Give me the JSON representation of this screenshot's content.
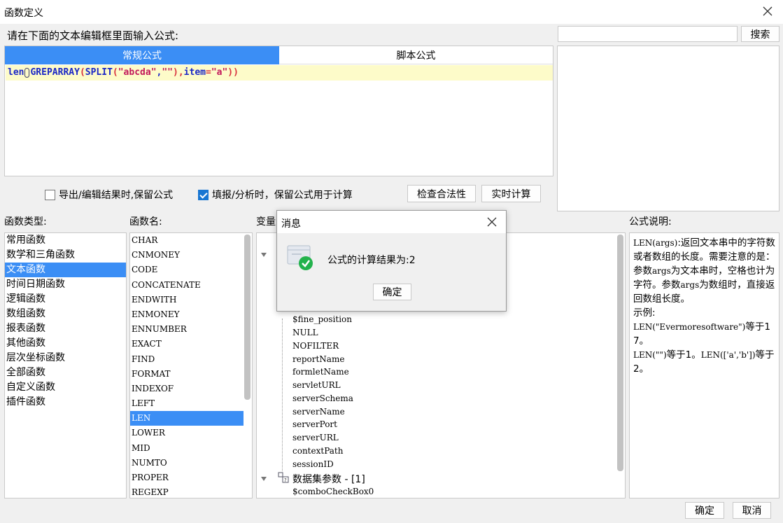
{
  "window": {
    "title": "函数定义"
  },
  "prompt": "请在下面的文本编辑框里面输入公式:",
  "search": {
    "value": "",
    "button": "搜索"
  },
  "editor": {
    "tabs": [
      {
        "label": "常规公式",
        "selected": true
      },
      {
        "label": "脚本公式",
        "selected": false
      }
    ],
    "formula": {
      "p1": "len",
      "p2": "GREPARRAY",
      "p3": "(",
      "p4": "SPLIT",
      "p5": "(",
      "p6": "\"abcda\"",
      "p7": ",",
      "p8": "\"\"",
      "p9": "),",
      "p10": "item",
      "p11": "=",
      "p12": "\"a\"",
      "p13": "))"
    }
  },
  "options": {
    "export_keep": {
      "label": "导出/编辑结果时,保留公式",
      "checked": false
    },
    "fill_keep": {
      "label": "填报/分析时，保留公式用于计算",
      "checked": true
    },
    "check_button": "检查合法性",
    "realtime_button": "实时计算"
  },
  "labels": {
    "categories": "函数类型:",
    "functions": "函数名:",
    "variables": "变量",
    "description": "公式说明:"
  },
  "categories": [
    "常用函数",
    "数学和三角函数",
    "文本函数",
    "时间日期函数",
    "逻辑函数",
    "数组函数",
    "报表函数",
    "其他函数",
    "层次坐标函数",
    "全部函数",
    "自定义函数",
    "插件函数"
  ],
  "selected_category": "文本函数",
  "functions": [
    "CHAR",
    "CNMONEY",
    "CODE",
    "CONCATENATE",
    "ENDWITH",
    "ENMONEY",
    "ENNUMBER",
    "EXACT",
    "FIND",
    "FORMAT",
    "INDEXOF",
    "LEFT",
    "LEN",
    "LOWER",
    "MID",
    "NUMTO",
    "PROPER",
    "REGEXP"
  ],
  "selected_function": "LEN",
  "variables": {
    "items": [
      "$fine_position",
      "NULL",
      "NOFILTER",
      "reportName",
      "formletName",
      "servletURL",
      "serverSchema",
      "serverName",
      "serverPort",
      "serverURL",
      "contextPath",
      "sessionID"
    ],
    "group_label": "数据集参数 - [1]",
    "group_items": [
      "$comboCheckBox0"
    ]
  },
  "description": {
    "l1": "LEN",
    "l2": "(args)",
    "l3": ":返回文本串中的字符数或者数组的长度。需要注意的是：参数",
    "l4": "args",
    "l5": "为文本串时，空格也计为字符。参数",
    "l6": "args",
    "l7": "为数组时，直接返回数组长度。",
    "l8": "示例:",
    "l9": "LEN(\"Evermoresoftware\")",
    "l10": "等于17。",
    "l11": "LEN(\"\")",
    "l12": "等于1。",
    "l13": "LEN(['a','b'])",
    "l14": "等于2。"
  },
  "footer": {
    "ok": "确定",
    "cancel": "取消"
  },
  "dialog": {
    "title": "消息",
    "message": "公式的计算结果为:2",
    "ok": "确定"
  },
  "colors": {
    "accent": "#3b8ef5",
    "formula_bg": "#fdfbc9",
    "function_text": "#1a26c6",
    "string_text": "#c2185b",
    "success_green": "#22b24c"
  }
}
